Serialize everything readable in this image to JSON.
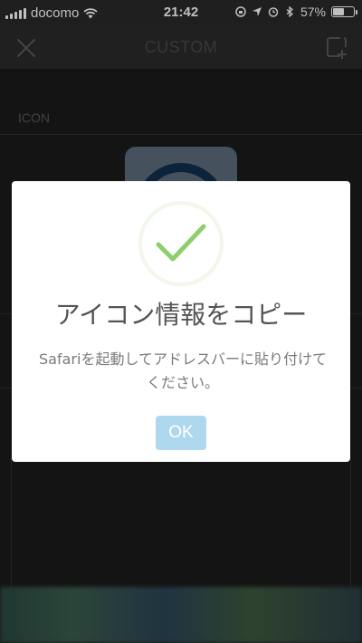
{
  "status_bar": {
    "carrier": "docomo",
    "time": "21:42",
    "battery_percent": "57%",
    "battery_level": 0.57,
    "icons": [
      "signal-icon",
      "wifi-icon",
      "screen-lock-icon",
      "location-icon",
      "alarm-icon",
      "bluetooth-icon",
      "battery-icon"
    ]
  },
  "navbar": {
    "title": "CUSTOM",
    "left_icon": "close-icon",
    "right_icon": "add-square-icon"
  },
  "content": {
    "section_label": "ICON"
  },
  "dialog": {
    "icon": "check-icon",
    "title": "アイコン情報をコピー",
    "message": "Safariを起動してアドレスバーに貼り付けてください。",
    "ok_label": "OK",
    "colors": {
      "check": "#8fce6f",
      "ok_button": "#add8ee"
    }
  }
}
